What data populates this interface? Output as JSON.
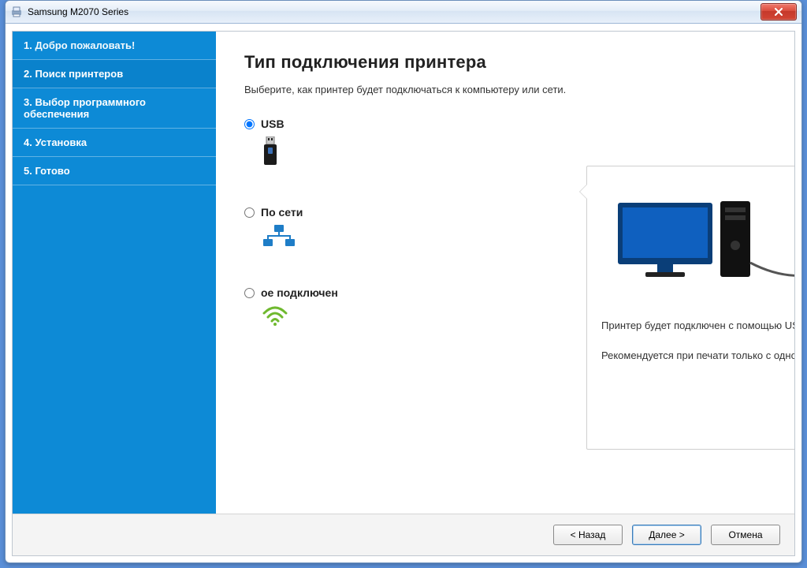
{
  "window": {
    "title": "Samsung M2070 Series"
  },
  "sidebar": {
    "steps": [
      {
        "label": "1. Добро пожаловать!",
        "state": "done"
      },
      {
        "label": "2. Поиск принтеров",
        "state": "active"
      },
      {
        "label": "3. Выбор программного обеспечения",
        "state": "pending"
      },
      {
        "label": "4. Установка",
        "state": "pending"
      },
      {
        "label": "5. Готово",
        "state": "pending"
      }
    ]
  },
  "content": {
    "title": "Тип подключения принтера",
    "subtitle": "Выберите, как принтер будет подключаться к компьютеру или сети.",
    "options": [
      {
        "id": "usb",
        "label": "USB",
        "selected": true
      },
      {
        "id": "network",
        "label": "По сети",
        "selected": false
      },
      {
        "id": "wireless",
        "label": "ое подключен",
        "selected": false
      }
    ],
    "preview": {
      "line1": "Принтер будет подключен с помощью USB-кабеля.",
      "line2": "Рекомендуется при печати только с одного компьютера."
    }
  },
  "footer": {
    "back": "< Назад",
    "next": "Далее >",
    "cancel": "Отмена"
  },
  "colors": {
    "sidebar": "#0d8ad6",
    "accent": "#1e7dc7",
    "close": "#d94b3c"
  }
}
